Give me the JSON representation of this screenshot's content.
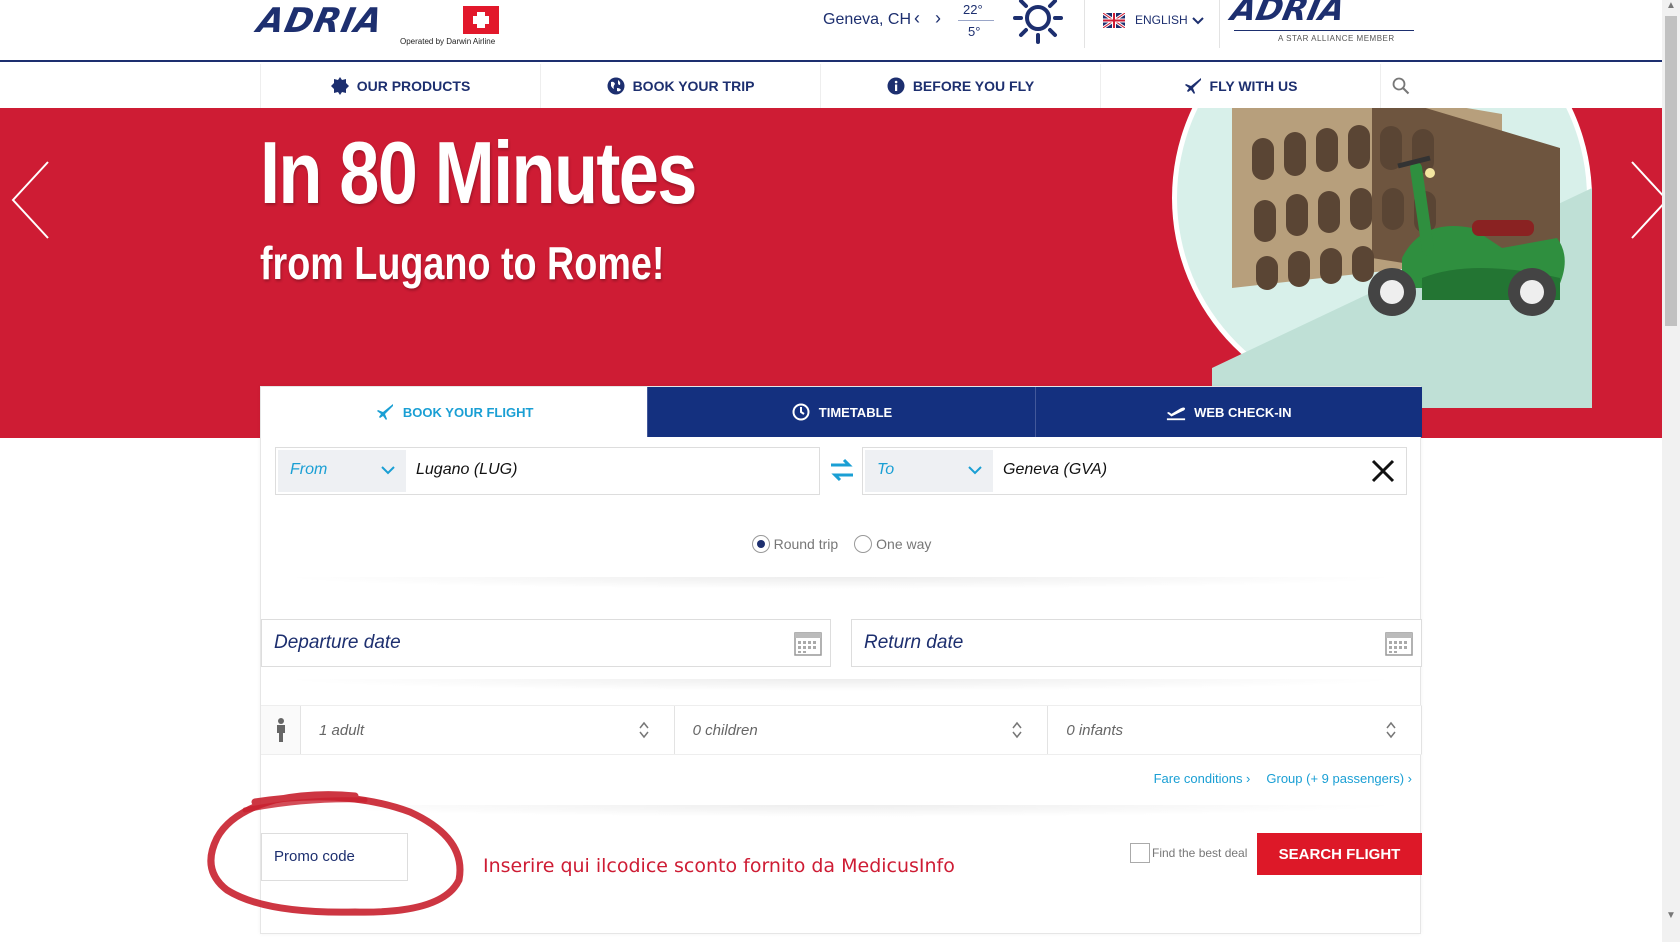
{
  "header": {
    "logo_text": "ADRIA",
    "logo_sub": "Operated by Darwin Airline",
    "weather": {
      "city": "Geneva, CH",
      "prev_label": "‹",
      "next_label": "›",
      "temp_high": "22°",
      "temp_low": "5°",
      "icon": "sun-icon"
    },
    "language": {
      "label": "ENGLISH",
      "flag_icon": "uk-flag-icon"
    },
    "alliance_logo_text": "ADRIA",
    "alliance_sub": "A STAR ALLIANCE MEMBER"
  },
  "nav": {
    "items": [
      {
        "label": "OUR PRODUCTS",
        "icon": "badge-icon"
      },
      {
        "label": "BOOK YOUR TRIP",
        "icon": "globe-icon"
      },
      {
        "label": "BEFORE YOU FLY",
        "icon": "info-icon"
      },
      {
        "label": "FLY WITH US",
        "icon": "plane-icon"
      }
    ],
    "search_icon": "search-icon"
  },
  "hero": {
    "title": "In 80 Minutes",
    "subtitle": "from Lugano to Rome!",
    "illustration": "colosseum-scooter-illustration"
  },
  "booking": {
    "tabs": [
      {
        "label": "BOOK YOUR FLIGHT",
        "icon": "plane-icon",
        "active": true
      },
      {
        "label": "TIMETABLE",
        "icon": "clock-icon",
        "active": false
      },
      {
        "label": "WEB CHECK-IN",
        "icon": "takeoff-icon",
        "active": false
      }
    ],
    "from": {
      "select_label": "From",
      "value": "Lugano (LUG)"
    },
    "to": {
      "select_label": "To",
      "value": "Geneva (GVA)"
    },
    "trip_type": {
      "options": [
        "Round trip",
        "One way"
      ],
      "selected": "Round trip"
    },
    "departure_placeholder": "Departure date",
    "return_placeholder": "Return date",
    "passengers": {
      "adults": "1 adult",
      "children": "0 children",
      "infants": "0 infants"
    },
    "links": {
      "fare_conditions": "Fare conditions  ›",
      "group": "Group (+ 9 passengers)  ›"
    },
    "promo_placeholder": "Promo code",
    "annotation_note": "Inserire qui ilcodice sconto  fornito da MedicusInfo",
    "best_deal_label": "Find the best deal",
    "search_button": "SEARCH FLIGHT"
  },
  "colors": {
    "brand_navy": "#1d2f6f",
    "hero_red": "#ce1c34",
    "accent_blue": "#1a9fd4",
    "button_red": "#dd1828",
    "tab_navy": "#14307f"
  }
}
